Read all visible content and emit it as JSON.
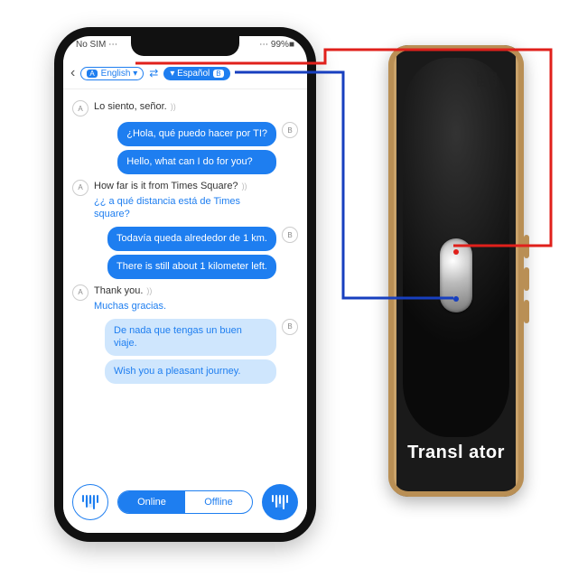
{
  "statusbar": {
    "left": "No SIM ⋯",
    "right": "⋯ 99%■"
  },
  "header": {
    "chipA_badge": "A",
    "langA": "English ▾",
    "langB": "▾ Español",
    "chipB_badge": "B"
  },
  "chat": {
    "m1": "Lo siento, señor.",
    "b1a": "¿Hola, qué puedo hacer por TI?",
    "b1b": "Hello, what can I do for you?",
    "m2": "How far is it from Times Square?",
    "m2sub": "¿¿ a qué distancia está de Times square?",
    "b2a": "Todavía queda alrededor de 1 km.",
    "b2b": "There is still about 1 kilometer left.",
    "m3": "Thank you.",
    "m3sub": "Muchas gracias.",
    "b3a": "De nada que tengas un buen viaje.",
    "b3b": "Wish you a pleasant journey."
  },
  "bottombar": {
    "online": "Online",
    "offline": "Offline"
  },
  "device": {
    "brand": "Transl ator"
  },
  "colors": {
    "accent": "#1e7ef0",
    "wireA": "#e0201b",
    "wireB": "#173fbf"
  }
}
